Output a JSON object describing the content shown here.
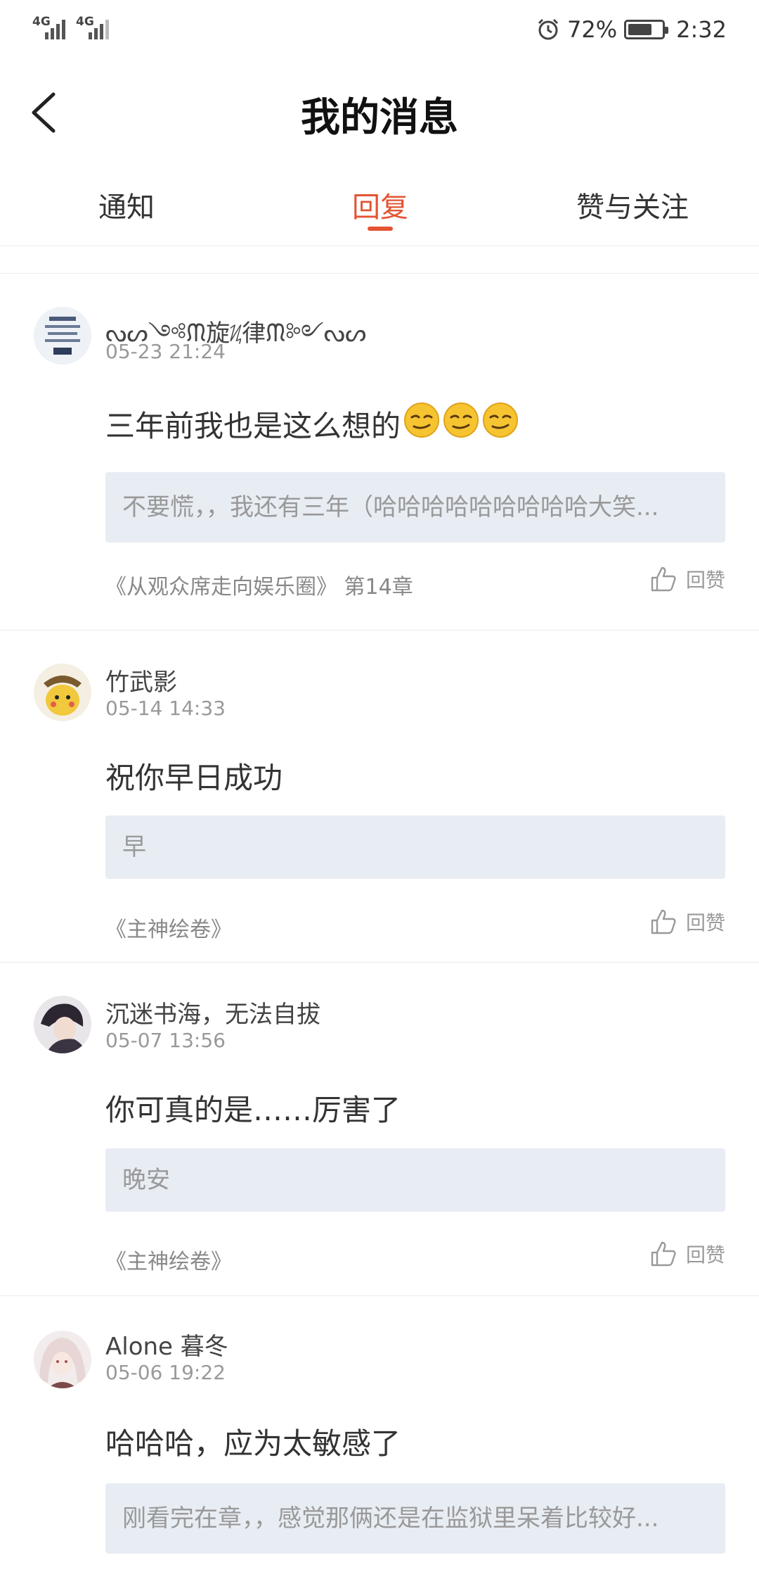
{
  "status": {
    "sig1": "4G",
    "sig2": "4G",
    "battery_pct": "72%",
    "battery_level": 0.72,
    "time": "2:32"
  },
  "header": {
    "title": "我的消息"
  },
  "tabs": [
    "通知",
    "回复",
    "赞与关注"
  ],
  "active_tab": "回复",
  "messages": [
    {
      "user": "ᔓᔕ༺ᙏ旋ᜰ律ᙏ༻ᔓᔕ",
      "time": "05-23 21:24",
      "text": "三年前我也是这么想的",
      "emoji_count": 3,
      "quote": "不要慌，，我还有三年（哈哈哈哈哈哈哈哈哈大笑...",
      "book": "《从观众席走向娱乐圈》 第14章",
      "like_label": "回赞"
    },
    {
      "user": "竹武影",
      "time": "05-14 14:33",
      "text": "祝你早日成功",
      "quote": "早",
      "book": "《主神绘卷》",
      "like_label": "回赞"
    },
    {
      "user": "沉迷书海，无法自拔",
      "time": "05-07 13:56",
      "text": "你可真的是……厉害了",
      "quote": "晚安",
      "book": "《主神绘卷》",
      "like_label": "回赞"
    },
    {
      "user": "Alone 暮冬",
      "time": "05-06 19:22",
      "text": "哈哈哈，应为太敏感了",
      "quote": "刚看完在章，，感觉那俩还是在监狱里呆着比较好...",
      "book": "",
      "like_label": ""
    }
  ],
  "colors": {
    "accent": "#e35434",
    "quote_bg": "#e8ecf3"
  }
}
